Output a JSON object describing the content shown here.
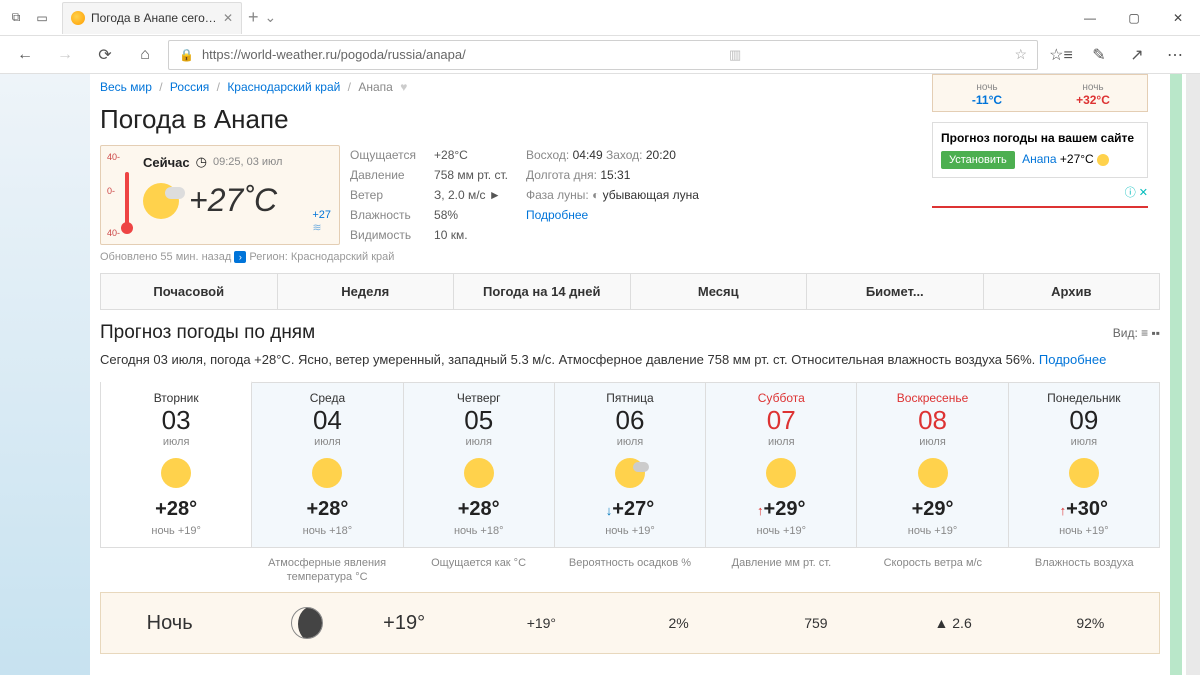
{
  "browser": {
    "tabTitle": "Погода в Анапе сегодн",
    "url": "https://world-weather.ru/pogoda/russia/anapa/"
  },
  "breadcrumb": {
    "items": [
      "Весь мир",
      "Россия",
      "Краснодарский край"
    ],
    "last": "Анапа"
  },
  "h1": "Погода в Анапе",
  "now": {
    "label": "Сейчас",
    "time": "09:25, 03 июл",
    "temp": "+27˚C",
    "sea": "+27",
    "scale": {
      "t0": "40-",
      "t1": "0-",
      "t2": "40-"
    }
  },
  "details": {
    "rows": [
      {
        "label": "Ощущается",
        "value": "+28°C"
      },
      {
        "label": "Давление",
        "value": "758 мм рт. ст."
      },
      {
        "label": "Ветер",
        "value": "З, 2.0 м/с ►"
      },
      {
        "label": "Влажность",
        "value": "58%"
      },
      {
        "label": "Видимость",
        "value": "10 км."
      }
    ],
    "sun": {
      "rise_l": "Восход:",
      "rise": "04:49",
      "set_l": "Заход:",
      "set": "20:20"
    },
    "daylen": {
      "l": "Долгота дня:",
      "v": "15:31"
    },
    "moon": {
      "l": "Фаза луны:",
      "v": "убывающая луна"
    },
    "more": "Подробнее"
  },
  "updated": "Обновлено 55 мин. назад",
  "region_l": "Регион:",
  "region": "Краснодарский край",
  "tabs": [
    "Почасовой",
    "Неделя",
    "Погода на 14 дней",
    "Месяц",
    "Биомет...",
    "Архив"
  ],
  "forecast": {
    "title": "Прогноз погоды по дням",
    "view_l": "Вид:",
    "summary": "Сегодня 03 июля, погода +28°C. Ясно, ветер умеренный, западный 5.3 м/с. Атмосферное давление 758 мм рт. ст. Относительная влажность воздуха 56%.",
    "more": "Подробнее",
    "days": [
      {
        "dname": "Вторник",
        "dnum": "03",
        "dmon": "июля",
        "temp": "+28°",
        "night": "ночь +19°",
        "weekend": false,
        "cloud": false,
        "arrow": ""
      },
      {
        "dname": "Среда",
        "dnum": "04",
        "dmon": "июля",
        "temp": "+28°",
        "night": "ночь +18°",
        "weekend": false,
        "cloud": false,
        "arrow": ""
      },
      {
        "dname": "Четверг",
        "dnum": "05",
        "dmon": "июля",
        "temp": "+28°",
        "night": "ночь +18°",
        "weekend": false,
        "cloud": false,
        "arrow": ""
      },
      {
        "dname": "Пятница",
        "dnum": "06",
        "dmon": "июля",
        "temp": "+27°",
        "night": "ночь +19°",
        "weekend": false,
        "cloud": true,
        "arrow": "down"
      },
      {
        "dname": "Суббота",
        "dnum": "07",
        "dmon": "июля",
        "temp": "+29°",
        "night": "ночь +19°",
        "weekend": true,
        "cloud": false,
        "arrow": "up"
      },
      {
        "dname": "Воскресенье",
        "dnum": "08",
        "dmon": "июля",
        "temp": "+29°",
        "night": "ночь +19°",
        "weekend": true,
        "cloud": false,
        "arrow": ""
      },
      {
        "dname": "Понедельник",
        "dnum": "09",
        "dmon": "июля",
        "temp": "+30°",
        "night": "ночь +19°",
        "weekend": false,
        "cloud": false,
        "arrow": "up"
      }
    ]
  },
  "hourheads": [
    "",
    "Атмосферные явления температура °C",
    "Ощущается как °C",
    "Вероятность осадков %",
    "Давление мм рт. ст.",
    "Скорость ветра м/с",
    "Влажность воздуха"
  ],
  "hourrow": {
    "label": "Ночь",
    "temp": "+19°",
    "feels": "+19°",
    "precip": "2%",
    "pressure": "759",
    "wind": "▲ 2.6",
    "humidity": "92%"
  },
  "side": {
    "min_l": "ночь",
    "min": "-11°C",
    "max_l": "ночь",
    "max": "+32°C",
    "promo_t": "Прогноз погоды на вашем сайте",
    "install": "Установить",
    "city": "Анапа",
    "ctemp": "+27°C",
    "ad": "ⓘ ✕"
  }
}
